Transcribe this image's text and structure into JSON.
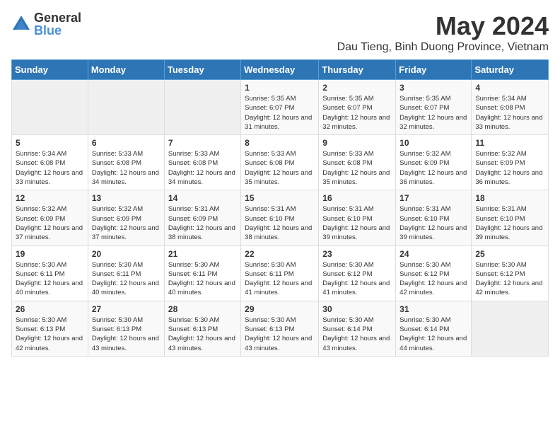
{
  "logo": {
    "general": "General",
    "blue": "Blue"
  },
  "title": {
    "month_year": "May 2024",
    "location": "Dau Tieng, Binh Duong Province, Vietnam"
  },
  "days_of_week": [
    "Sunday",
    "Monday",
    "Tuesday",
    "Wednesday",
    "Thursday",
    "Friday",
    "Saturday"
  ],
  "weeks": [
    [
      {
        "day": "",
        "info": ""
      },
      {
        "day": "",
        "info": ""
      },
      {
        "day": "",
        "info": ""
      },
      {
        "day": "1",
        "info": "Sunrise: 5:35 AM\nSunset: 6:07 PM\nDaylight: 12 hours and 31 minutes."
      },
      {
        "day": "2",
        "info": "Sunrise: 5:35 AM\nSunset: 6:07 PM\nDaylight: 12 hours and 32 minutes."
      },
      {
        "day": "3",
        "info": "Sunrise: 5:35 AM\nSunset: 6:07 PM\nDaylight: 12 hours and 32 minutes."
      },
      {
        "day": "4",
        "info": "Sunrise: 5:34 AM\nSunset: 6:08 PM\nDaylight: 12 hours and 33 minutes."
      }
    ],
    [
      {
        "day": "5",
        "info": "Sunrise: 5:34 AM\nSunset: 6:08 PM\nDaylight: 12 hours and 33 minutes."
      },
      {
        "day": "6",
        "info": "Sunrise: 5:33 AM\nSunset: 6:08 PM\nDaylight: 12 hours and 34 minutes."
      },
      {
        "day": "7",
        "info": "Sunrise: 5:33 AM\nSunset: 6:08 PM\nDaylight: 12 hours and 34 minutes."
      },
      {
        "day": "8",
        "info": "Sunrise: 5:33 AM\nSunset: 6:08 PM\nDaylight: 12 hours and 35 minutes."
      },
      {
        "day": "9",
        "info": "Sunrise: 5:33 AM\nSunset: 6:08 PM\nDaylight: 12 hours and 35 minutes."
      },
      {
        "day": "10",
        "info": "Sunrise: 5:32 AM\nSunset: 6:09 PM\nDaylight: 12 hours and 36 minutes."
      },
      {
        "day": "11",
        "info": "Sunrise: 5:32 AM\nSunset: 6:09 PM\nDaylight: 12 hours and 36 minutes."
      }
    ],
    [
      {
        "day": "12",
        "info": "Sunrise: 5:32 AM\nSunset: 6:09 PM\nDaylight: 12 hours and 37 minutes."
      },
      {
        "day": "13",
        "info": "Sunrise: 5:32 AM\nSunset: 6:09 PM\nDaylight: 12 hours and 37 minutes."
      },
      {
        "day": "14",
        "info": "Sunrise: 5:31 AM\nSunset: 6:09 PM\nDaylight: 12 hours and 38 minutes."
      },
      {
        "day": "15",
        "info": "Sunrise: 5:31 AM\nSunset: 6:10 PM\nDaylight: 12 hours and 38 minutes."
      },
      {
        "day": "16",
        "info": "Sunrise: 5:31 AM\nSunset: 6:10 PM\nDaylight: 12 hours and 39 minutes."
      },
      {
        "day": "17",
        "info": "Sunrise: 5:31 AM\nSunset: 6:10 PM\nDaylight: 12 hours and 39 minutes."
      },
      {
        "day": "18",
        "info": "Sunrise: 5:31 AM\nSunset: 6:10 PM\nDaylight: 12 hours and 39 minutes."
      }
    ],
    [
      {
        "day": "19",
        "info": "Sunrise: 5:30 AM\nSunset: 6:11 PM\nDaylight: 12 hours and 40 minutes."
      },
      {
        "day": "20",
        "info": "Sunrise: 5:30 AM\nSunset: 6:11 PM\nDaylight: 12 hours and 40 minutes."
      },
      {
        "day": "21",
        "info": "Sunrise: 5:30 AM\nSunset: 6:11 PM\nDaylight: 12 hours and 40 minutes."
      },
      {
        "day": "22",
        "info": "Sunrise: 5:30 AM\nSunset: 6:11 PM\nDaylight: 12 hours and 41 minutes."
      },
      {
        "day": "23",
        "info": "Sunrise: 5:30 AM\nSunset: 6:12 PM\nDaylight: 12 hours and 41 minutes."
      },
      {
        "day": "24",
        "info": "Sunrise: 5:30 AM\nSunset: 6:12 PM\nDaylight: 12 hours and 42 minutes."
      },
      {
        "day": "25",
        "info": "Sunrise: 5:30 AM\nSunset: 6:12 PM\nDaylight: 12 hours and 42 minutes."
      }
    ],
    [
      {
        "day": "26",
        "info": "Sunrise: 5:30 AM\nSunset: 6:13 PM\nDaylight: 12 hours and 42 minutes."
      },
      {
        "day": "27",
        "info": "Sunrise: 5:30 AM\nSunset: 6:13 PM\nDaylight: 12 hours and 43 minutes."
      },
      {
        "day": "28",
        "info": "Sunrise: 5:30 AM\nSunset: 6:13 PM\nDaylight: 12 hours and 43 minutes."
      },
      {
        "day": "29",
        "info": "Sunrise: 5:30 AM\nSunset: 6:13 PM\nDaylight: 12 hours and 43 minutes."
      },
      {
        "day": "30",
        "info": "Sunrise: 5:30 AM\nSunset: 6:14 PM\nDaylight: 12 hours and 43 minutes."
      },
      {
        "day": "31",
        "info": "Sunrise: 5:30 AM\nSunset: 6:14 PM\nDaylight: 12 hours and 44 minutes."
      },
      {
        "day": "",
        "info": ""
      }
    ]
  ]
}
